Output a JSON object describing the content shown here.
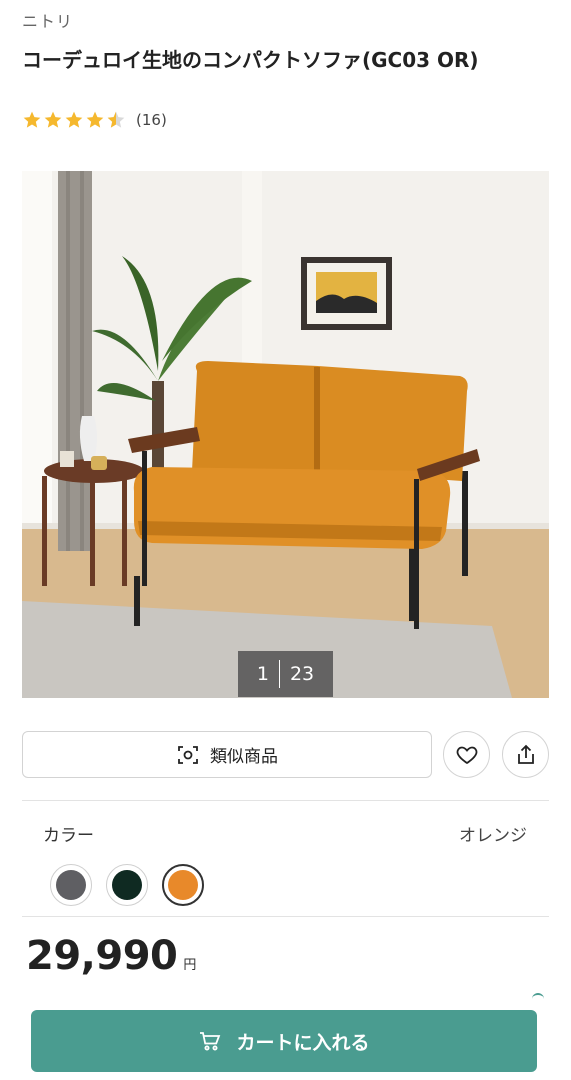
{
  "brand": "ニトリ",
  "product": {
    "title": "コーデュロイ生地のコンパクトソファ(GC03 OR)",
    "rating": 4.5,
    "review_count": "(16)"
  },
  "gallery": {
    "current": "1",
    "total": "23"
  },
  "actions": {
    "similar_label": "類似商品",
    "icons": [
      "scan-icon",
      "heart-icon",
      "share-icon"
    ]
  },
  "color": {
    "label": "カラー",
    "selected_value": "オレンジ",
    "options": [
      {
        "name": "gray",
        "hex": "#5f5f63"
      },
      {
        "name": "dark-green",
        "hex": "#0f2a22"
      },
      {
        "name": "orange",
        "hex": "#e8892a"
      }
    ],
    "selected_index": 2
  },
  "price": {
    "value": "29,990",
    "unit": "円"
  },
  "cart": {
    "label": "カートに入れる",
    "icon": "cart-icon"
  },
  "colors": {
    "accent": "#4a9c90",
    "star": "#f5b82e"
  }
}
